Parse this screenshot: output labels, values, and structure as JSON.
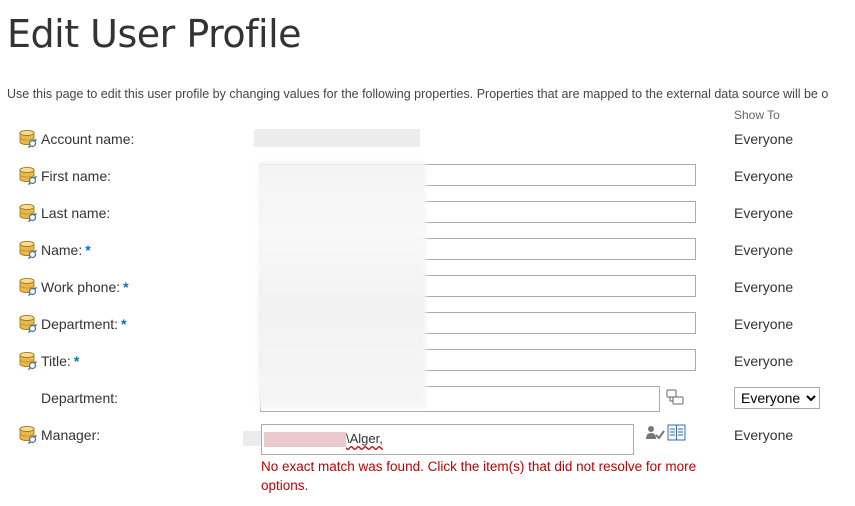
{
  "page": {
    "title": "Edit User Profile",
    "description": "Use this page to edit this user profile by changing values for the following properties. Properties that are mapped to the external data source will be o",
    "show_to_header": "Show To"
  },
  "properties": [
    {
      "label": "Account name:",
      "required": false,
      "value": "",
      "show_to": "Everyone"
    },
    {
      "label": "First name:",
      "required": false,
      "value": "",
      "show_to": "Everyone"
    },
    {
      "label": "Last name:",
      "required": false,
      "value": "",
      "show_to": "Everyone"
    },
    {
      "label": "Name:",
      "required": true,
      "value": "",
      "show_to": "Everyone"
    },
    {
      "label": "Work phone:",
      "required": true,
      "value": "",
      "show_to": "Everyone"
    },
    {
      "label": "Department:",
      "required": true,
      "value": "",
      "show_to": "Everyone"
    },
    {
      "label": "Title:",
      "required": true,
      "value": "",
      "show_to": "Everyone"
    },
    {
      "label": "Department:",
      "required": false,
      "value": "",
      "show_to": "Everyone"
    },
    {
      "label": "Manager:",
      "required": false,
      "value": "\\Alger,",
      "show_to": "Everyone"
    }
  ],
  "required_marker": "*",
  "error_message": "No exact match was found. Click the item(s) that did not resolve for more options.",
  "icons": {
    "property": "database-icon",
    "taxonomy": "term-picker-icon",
    "check_names": "check-names-icon",
    "browse": "address-book-icon"
  },
  "colors": {
    "required": "#0072c6",
    "error": "#c00000",
    "icon_gold": "#e8b84a",
    "icon_blue": "#3a6ea8"
  }
}
